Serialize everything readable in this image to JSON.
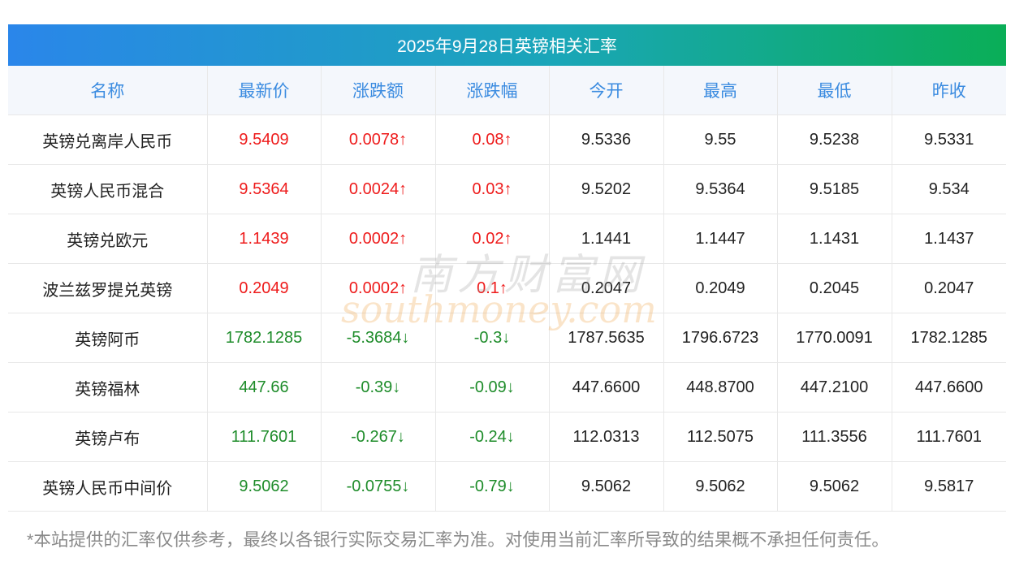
{
  "title": "2025年9月28日英镑相关汇率",
  "columns": [
    "名称",
    "最新价",
    "涨跌额",
    "涨跌幅",
    "今开",
    "最高",
    "最低",
    "昨收"
  ],
  "rows": [
    {
      "name": "英镑兑离岸人民币",
      "latest": "9.5409",
      "change": "0.0078↑",
      "change_pct": "0.08↑",
      "open": "9.5336",
      "high": "9.55",
      "low": "9.5238",
      "prev_close": "9.5331",
      "trend": "up"
    },
    {
      "name": "英镑人民币混合",
      "latest": "9.5364",
      "change": "0.0024↑",
      "change_pct": "0.03↑",
      "open": "9.5202",
      "high": "9.5364",
      "low": "9.5185",
      "prev_close": "9.534",
      "trend": "up"
    },
    {
      "name": "英镑兑欧元",
      "latest": "1.1439",
      "change": "0.0002↑",
      "change_pct": "0.02↑",
      "open": "1.1441",
      "high": "1.1447",
      "low": "1.1431",
      "prev_close": "1.1437",
      "trend": "up"
    },
    {
      "name": "波兰兹罗提兑英镑",
      "latest": "0.2049",
      "change": "0.0002↑",
      "change_pct": "0.1↑",
      "open": "0.2047",
      "high": "0.2049",
      "low": "0.2045",
      "prev_close": "0.2047",
      "trend": "up"
    },
    {
      "name": "英镑阿币",
      "latest": "1782.1285",
      "change": "-5.3684↓",
      "change_pct": "-0.3↓",
      "open": "1787.5635",
      "high": "1796.6723",
      "low": "1770.0091",
      "prev_close": "1782.1285",
      "trend": "down"
    },
    {
      "name": "英镑福林",
      "latest": "447.66",
      "change": "-0.39↓",
      "change_pct": "-0.09↓",
      "open": "447.6600",
      "high": "448.8700",
      "low": "447.2100",
      "prev_close": "447.6600",
      "trend": "down"
    },
    {
      "name": "英镑卢布",
      "latest": "111.7601",
      "change": "-0.267↓",
      "change_pct": "-0.24↓",
      "open": "112.0313",
      "high": "112.5075",
      "low": "111.3556",
      "prev_close": "111.7601",
      "trend": "down"
    },
    {
      "name": "英镑人民币中间价",
      "latest": "9.5062",
      "change": "-0.0755↓",
      "change_pct": "-0.79↓",
      "open": "9.5062",
      "high": "9.5062",
      "low": "9.5062",
      "prev_close": "9.5817",
      "trend": "down"
    }
  ],
  "footnote": "*本站提供的汇率仅供参考，最终以各银行实际交易汇率为准。对使用当前汇率所导致的结果概不承担任何责任。",
  "watermark": {
    "cn": "南方财富网",
    "en": "southmoney.com"
  },
  "colors": {
    "up": "#ee1b1b",
    "down": "#1e8c2a",
    "header_text": "#3a8be0",
    "title_gradient_start": "#2a86ea",
    "title_gradient_end": "#0aae57"
  }
}
